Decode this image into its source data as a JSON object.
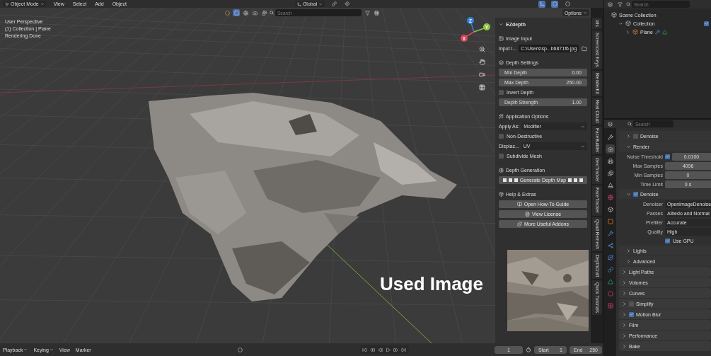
{
  "header": {
    "mode": "Object Mode",
    "menus": [
      "View",
      "Select",
      "Add",
      "Object"
    ],
    "orientation": "Global",
    "search": {
      "placeholder": "Search"
    },
    "options": "Options"
  },
  "viewport": {
    "overlay_text": [
      "User Perspective",
      "(1) Collection | Plane",
      "Rendering Done"
    ],
    "gizmo": [
      {
        "label": "Z",
        "color": "#2f83e3"
      },
      {
        "label": "Y",
        "color": "#8bc53f"
      },
      {
        "label": "X",
        "color": "#e5435a"
      }
    ],
    "caption": "Used Image"
  },
  "addon_panel": {
    "title": "EZdepth",
    "sections": [
      {
        "title": "Image Input",
        "items": [
          {
            "kind": "file",
            "label": "Input I...",
            "value": "C:\\Users\\sp...b6871f6.jpg"
          }
        ]
      },
      {
        "title": "Depth Settings",
        "items": [
          {
            "kind": "slider",
            "label": "Min Depth",
            "value": "0.00"
          },
          {
            "kind": "slider",
            "label": "Max Depth",
            "value": "250.00"
          },
          {
            "kind": "checkbox",
            "label": "Invert Depth",
            "checked": false
          },
          {
            "kind": "slider",
            "label": "Depth Strength",
            "value": "1.00"
          }
        ]
      },
      {
        "title": "Application Options",
        "items": [
          {
            "kind": "dropdown",
            "label": "Apply As:",
            "value": "Modifier"
          },
          {
            "kind": "checkbox",
            "label": "Non-Destructive",
            "checked": false
          },
          {
            "kind": "dropdown",
            "label": "Displac...",
            "value": "UV"
          },
          {
            "kind": "checkbox",
            "label": "Subdivide Mesh",
            "checked": false
          }
        ]
      },
      {
        "title": "Depth Generation",
        "items": [
          {
            "kind": "action",
            "label": "Generate Depth Map"
          }
        ]
      },
      {
        "title": "Help & Extras",
        "items": [
          {
            "kind": "button",
            "label": "Open How-To Guide"
          },
          {
            "kind": "button",
            "label": "View License"
          },
          {
            "kind": "button",
            "label": "More Useful Addons"
          }
        ]
      }
    ]
  },
  "sidebar_tabs": [
    "ials",
    "Screencast Keys",
    "BlenderKit",
    "Real Cloud",
    "FaceBuilder",
    "GeoTracker",
    "FaceTracker",
    "Quad Remesh",
    "DepthCraft",
    "Quick Tutorials"
  ],
  "outliner": {
    "search": {
      "placeholder": "Search"
    },
    "tree": [
      {
        "label": "Scene Collection",
        "children": [
          {
            "label": "Collection",
            "expanded": true,
            "checked": true,
            "children": [
              {
                "label": "Plane",
                "expanded": false
              }
            ]
          }
        ]
      }
    ]
  },
  "properties": {
    "search": {
      "placeholder": "Search"
    },
    "tabs": [
      {
        "kind": "tool",
        "selected": false
      },
      {
        "kind": "render",
        "selected": true
      },
      {
        "kind": "output",
        "selected": false
      },
      {
        "kind": "viewlayer",
        "selected": false
      },
      {
        "kind": "scene",
        "selected": false
      },
      {
        "kind": "world",
        "selected": false
      },
      {
        "kind": "collection",
        "selected": false
      },
      {
        "kind": "object",
        "selected": false
      },
      {
        "kind": "modifier",
        "selected": false
      },
      {
        "kind": "particles",
        "selected": false
      },
      {
        "kind": "physics",
        "selected": false
      },
      {
        "kind": "constraints",
        "selected": false
      },
      {
        "kind": "data",
        "selected": false
      },
      {
        "kind": "material",
        "selected": false
      },
      {
        "kind": "texture",
        "selected": false
      }
    ],
    "subpanels": [
      {
        "label": "Denoise",
        "expanded": false,
        "checked": false
      },
      {
        "label": "Render",
        "expanded": true,
        "fields": [
          {
            "kind": "number",
            "label": "Noise Threshold",
            "value": "0.0100",
            "checked": true
          },
          {
            "kind": "number",
            "label": "Max Samples",
            "value": "4096"
          },
          {
            "kind": "number",
            "label": "Min Samples",
            "value": "0"
          },
          {
            "kind": "number",
            "label": "Time Limit",
            "value": "0 s"
          }
        ]
      },
      {
        "label": "Denoise",
        "expanded": true,
        "checked": true,
        "fields": [
          {
            "kind": "dropdown",
            "label": "Denoiser",
            "value": "OpenImageDenoise"
          },
          {
            "kind": "dropdown",
            "label": "Passes",
            "value": "Albedo and Normal"
          },
          {
            "kind": "dropdown",
            "label": "Prefilter",
            "value": "Accurate"
          },
          {
            "kind": "dropdown",
            "label": "Quality",
            "value": "High"
          },
          {
            "kind": "checkbox",
            "label": "Use GPU",
            "checked": true
          }
        ]
      },
      {
        "label": "Lights",
        "expanded": false
      },
      {
        "label": "Advanced",
        "expanded": false
      }
    ],
    "panels": [
      {
        "label": "Light Paths",
        "expanded": false
      },
      {
        "label": "Volumes",
        "expanded": false
      },
      {
        "label": "Curves",
        "expanded": false
      },
      {
        "label": "Simplify",
        "expanded": false,
        "checked": false
      },
      {
        "label": "Motion Blur",
        "expanded": false,
        "checked": true
      },
      {
        "label": "Film",
        "expanded": false
      },
      {
        "label": "Performance",
        "expanded": false
      },
      {
        "label": "Bake",
        "expanded": false
      }
    ]
  },
  "timeline": {
    "menus": [
      {
        "label": "Playback",
        "kind": "dropdown"
      },
      {
        "label": "Keying",
        "kind": "dropdown"
      },
      {
        "label": "View",
        "kind": "plain"
      },
      {
        "label": "Marker",
        "kind": "plain"
      }
    ],
    "current_frame": "1",
    "start": {
      "label": "Start",
      "value": "1"
    },
    "end": {
      "label": "End",
      "value": "250"
    }
  }
}
